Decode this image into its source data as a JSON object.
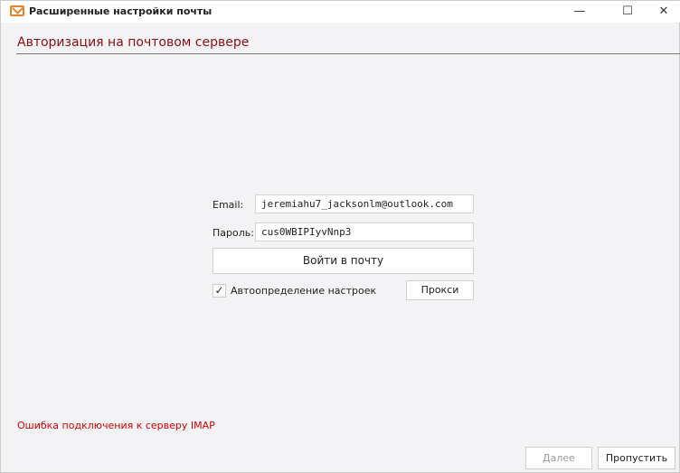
{
  "window": {
    "title": "Расширенные настройки почты",
    "minimize": "—",
    "maximize": "☐",
    "close": "✕"
  },
  "heading": "Авторизация на почтовом сервере",
  "form": {
    "email_label": "Email:",
    "email_value": "jeremiahu7_jacksonlm@outlook.com",
    "password_label": "Пароль:",
    "password_value": "cus0WBIPIyvNnp3",
    "login_button": "Войти в почту",
    "auto_checkbox": "Автоопределение настроек",
    "auto_checked": "✓",
    "proxy_button": "Прокси"
  },
  "error": "Ошибка подключения к серверу IMAP",
  "footer": {
    "next": "Далее",
    "skip": "Пропустить"
  }
}
